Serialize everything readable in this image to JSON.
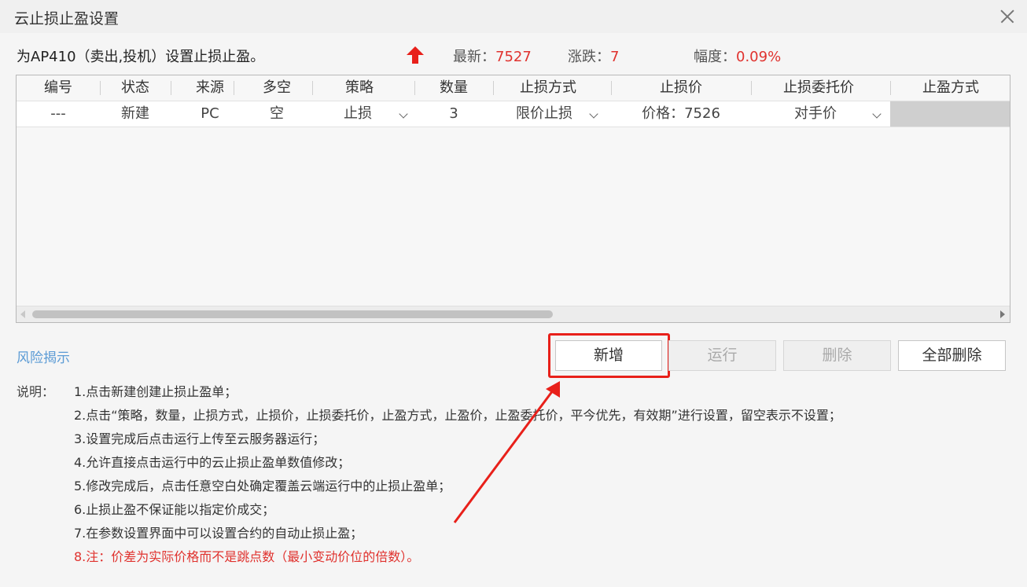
{
  "window": {
    "title": "云止损止盈设置"
  },
  "info": {
    "description": "为AP410（卖出,投机）设置止损止盈。",
    "latest_label": "最新：",
    "latest_value": "7527",
    "change_label": "涨跌：",
    "change_value": "7",
    "range_label": "幅度：",
    "range_value": "0.09%",
    "up_color": "#e8201a"
  },
  "table": {
    "columns": [
      "编号",
      "状态",
      "来源",
      "多空",
      "策略",
      "数量",
      "止损方式",
      "止损价",
      "止损委托价",
      "止盈方式"
    ],
    "rows": [
      {
        "id": "---",
        "status": "新建",
        "source": "PC",
        "direction": "空",
        "strategy": "止损",
        "quantity": "3",
        "stop_loss_method": "限价止损",
        "stop_loss_price": "价格：7526",
        "stop_loss_order_price": "对手价",
        "take_profit_method": ""
      }
    ]
  },
  "risk_link": "风险揭示",
  "buttons": {
    "add": "新增",
    "run": "运行",
    "delete": "删除",
    "delete_all": "全部删除"
  },
  "notes": {
    "label": "说明：",
    "items": [
      "1.点击新建创建止损止盈单；",
      "2.点击“策略，数量，止损方式，止损价，止损委托价，止盈方式，止盈价，止盈委托价，平今优先，有效期”进行设置，留空表示不设置；",
      "3.设置完成后点击运行上传至云服务器运行；",
      "4.允许直接点击运行中的云止损止盈单数值修改；",
      "5.修改完成后，点击任意空白处确定覆盖云端运行中的止损止盈单；",
      "6.止损止盈不保证能以指定价成交；",
      "7.在参数设置界面中可以设置合约的自动止损止盈；",
      "8.注：价差为实际价格而不是跳点数（最小变动价位的倍数）。"
    ]
  },
  "colors": {
    "accent_red": "#e0322e",
    "link_blue": "#5b9bd5",
    "annotation": "#e8201a"
  }
}
